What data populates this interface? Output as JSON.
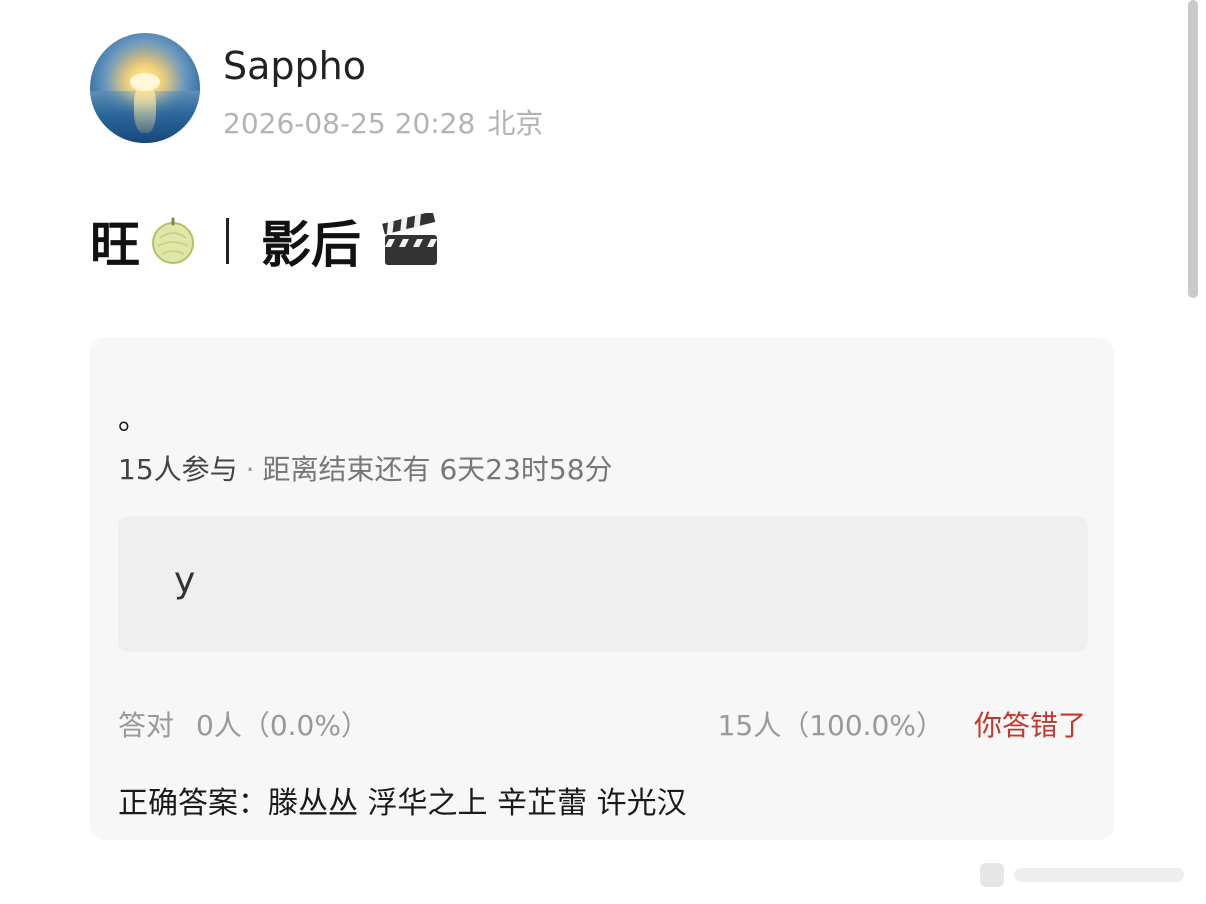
{
  "post": {
    "author": "Sappho",
    "datetime": "2026-08-25 20:28",
    "location": "北京",
    "title_left": "旺",
    "title_right": "影后"
  },
  "quiz": {
    "question": "。",
    "participants": "15人参与",
    "dot": "·",
    "time_left": "距离结束还有 6天23时58分",
    "option_label": "y",
    "correct_label": "答对",
    "correct_value": "0人（0.0%）",
    "wrong_value": "15人（100.0%）",
    "verdict": "你答错了",
    "answer": "正确答案：滕丛丛 浮华之上 辛芷蕾 许光汉"
  },
  "icons": {
    "melon": "melon-icon",
    "clapper": "clapper-board-icon"
  },
  "colors": {
    "verdict": "#c0392b"
  }
}
